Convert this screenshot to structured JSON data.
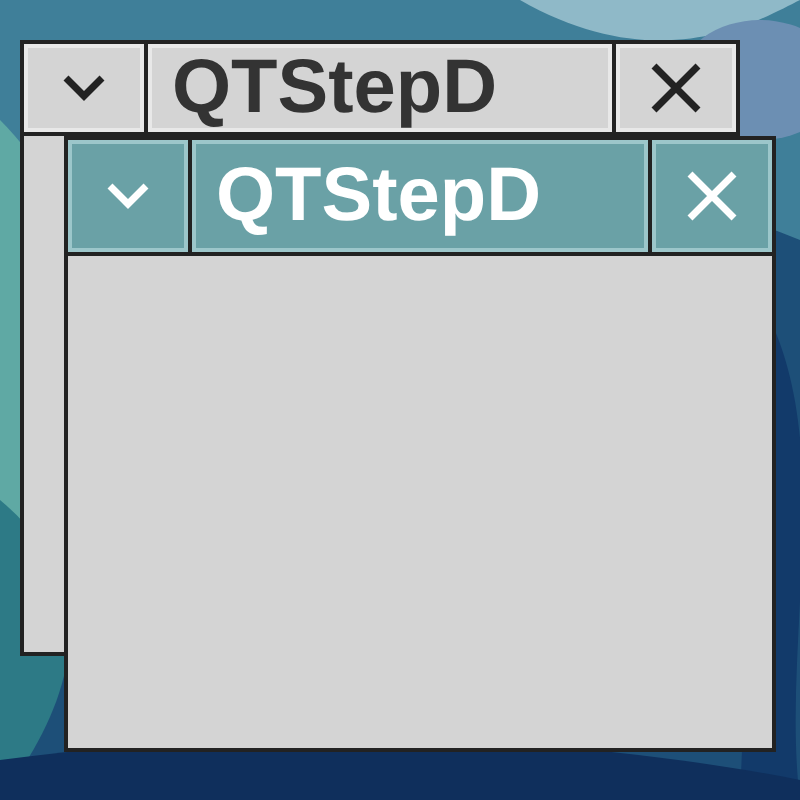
{
  "windows": [
    {
      "title": "QTStepD",
      "active": false
    },
    {
      "title": "QTStepD",
      "active": true
    }
  ]
}
